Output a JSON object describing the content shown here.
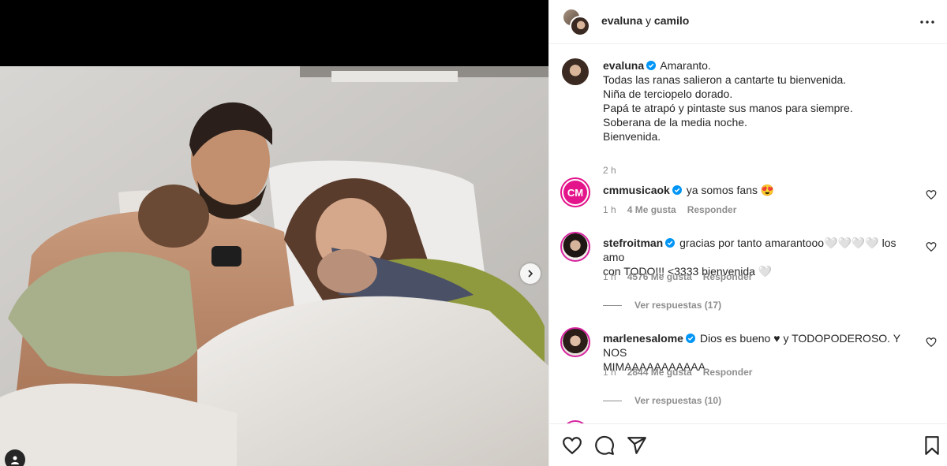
{
  "post": {
    "header": {
      "username": "evaluna",
      "connector": " y ",
      "coauthor": "camilo"
    },
    "caption": {
      "username": "evaluna",
      "lines": [
        "Amaranto.",
        "Todas las ranas salieron a cantarte tu bienvenida.",
        "Niña de terciopelo dorado.",
        "Papá te atrapó y pintaste sus manos para siempre.",
        "Soberana de la media noche.",
        "Bienvenida."
      ],
      "time": "2 h"
    },
    "comments": [
      {
        "username": "cmmusicaok",
        "avatar_text": "CM",
        "text": "ya somos fans 😍",
        "time": "1 h",
        "likes": "4 Me gusta",
        "reply_label": "Responder"
      },
      {
        "username": "stefroitman",
        "text_line1": "gracias por tanto amarantooo🤍🤍🤍🤍 los amo",
        "text_line2": "con TODO!!! <3333 bienvenida 🤍",
        "time": "1 h",
        "likes": "4576 Me gusta",
        "reply_label": "Responder",
        "view_replies": "Ver respuestas (17)"
      },
      {
        "username": "marlenesalome",
        "text_line1": "Dios es bueno ♥ y TODOPODEROSO. Y NOS",
        "text_line2": "MIMAAAAAAAAAAA",
        "time": "1 h",
        "likes": "2844 Me gusta",
        "reply_label": "Responder",
        "view_replies": "Ver respuestas (10)"
      }
    ]
  },
  "icons": {
    "more": "more-horizontal-icon",
    "verified": "verified-badge-icon",
    "like": "heart-icon",
    "comment": "comment-icon",
    "share": "share-icon",
    "save": "bookmark-icon",
    "next": "chevron-right-icon",
    "tags": "user-tag-icon"
  },
  "colors": {
    "verified": "#0095f6",
    "text": "#262626",
    "muted": "#8e8e8e",
    "border": "#efefef",
    "cm_brand": "#e4148b"
  }
}
